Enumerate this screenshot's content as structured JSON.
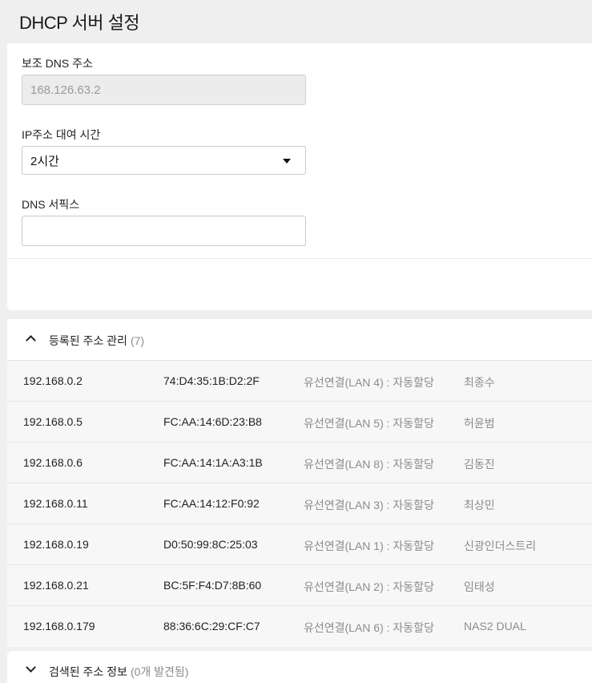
{
  "header": {
    "title": "DHCP 서버 설정"
  },
  "settings": {
    "secondary_dns": {
      "label": "보조 DNS 주소",
      "value": "168.126.63.2"
    },
    "lease_time": {
      "label": "IP주소 대여 시간",
      "value": "2시간"
    },
    "dns_suffix": {
      "label": "DNS 서픽스",
      "value": ""
    }
  },
  "registered": {
    "title": "등록된 주소 관리",
    "count": "(7)",
    "rows": [
      {
        "ip": "192.168.0.2",
        "mac": "74:D4:35:1B:D2:2F",
        "conn": "유선연결(LAN 4) : 자동할당",
        "name": "최종수"
      },
      {
        "ip": "192.168.0.5",
        "mac": "FC:AA:14:6D:23:B8",
        "conn": "유선연결(LAN 5) : 자동할당",
        "name": "허윤범"
      },
      {
        "ip": "192.168.0.6",
        "mac": "FC:AA:14:1A:A3:1B",
        "conn": "유선연결(LAN 8) : 자동할당",
        "name": "김동진"
      },
      {
        "ip": "192.168.0.11",
        "mac": "FC:AA:14:12:F0:92",
        "conn": "유선연결(LAN 3) : 자동할당",
        "name": "최상민"
      },
      {
        "ip": "192.168.0.19",
        "mac": "D0:50:99:8C:25:03",
        "conn": "유선연결(LAN 1) : 자동할당",
        "name": "신광인더스트리"
      },
      {
        "ip": "192.168.0.21",
        "mac": "BC:5F:F4:D7:8B:60",
        "conn": "유선연결(LAN 2) : 자동할당",
        "name": "임태성"
      },
      {
        "ip": "192.168.0.179",
        "mac": "88:36:6C:29:CF:C7",
        "conn": "유선연결(LAN 6) : 자동할당",
        "name": "NAS2 DUAL"
      }
    ]
  },
  "found": {
    "title": "검색된 주소 정보",
    "count": "(0개 발견됨)"
  },
  "icons": {
    "registered_toggle": "chevron-up-icon",
    "found_toggle": "chevron-down-icon",
    "lease_select": "caret-down-icon"
  }
}
